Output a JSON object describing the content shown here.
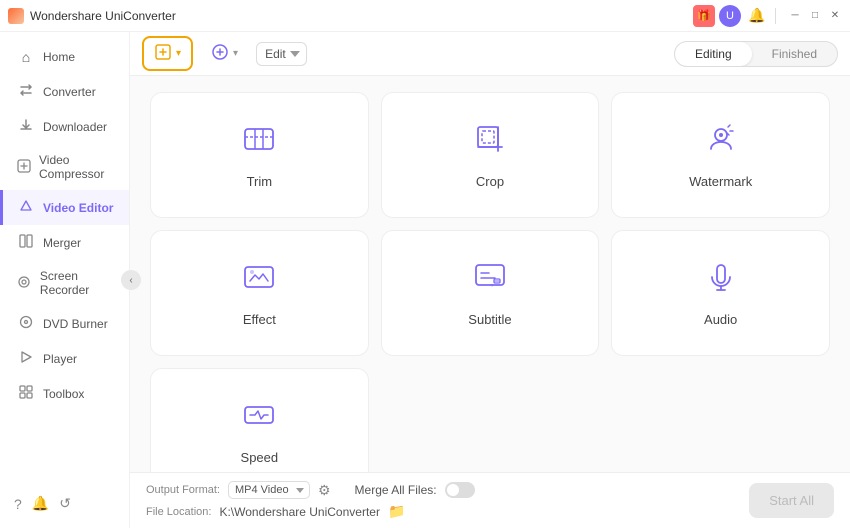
{
  "titleBar": {
    "title": "Wondershare UniConverter",
    "giftIcon": "🎁",
    "avatarLabel": "U",
    "bellIcon": "🔔",
    "minIcon": "─",
    "maxIcon": "□",
    "closeIcon": "✕"
  },
  "sidebar": {
    "items": [
      {
        "id": "home",
        "label": "Home",
        "icon": "⌂"
      },
      {
        "id": "converter",
        "label": "Converter",
        "icon": "⇄"
      },
      {
        "id": "downloader",
        "label": "Downloader",
        "icon": "↓"
      },
      {
        "id": "video-compressor",
        "label": "Video Compressor",
        "icon": "⊡"
      },
      {
        "id": "video-editor",
        "label": "Video Editor",
        "icon": "✏",
        "active": true
      },
      {
        "id": "merger",
        "label": "Merger",
        "icon": "⊕"
      },
      {
        "id": "screen-recorder",
        "label": "Screen Recorder",
        "icon": "◎"
      },
      {
        "id": "dvd-burner",
        "label": "DVD Burner",
        "icon": "💿"
      },
      {
        "id": "player",
        "label": "Player",
        "icon": "▶"
      },
      {
        "id": "toolbox",
        "label": "Toolbox",
        "icon": "⊞"
      }
    ],
    "bottomIcons": [
      "?",
      "🔔",
      "↺"
    ],
    "collapseLabel": "‹"
  },
  "toolbar": {
    "addFileLabel": "",
    "addFileArrow": "▾",
    "addFileIcon": "➕",
    "addSceneLabel": "",
    "addSceneArrow": "▾",
    "editOptions": [
      "Edit"
    ],
    "tabs": [
      {
        "id": "editing",
        "label": "Editing",
        "active": true
      },
      {
        "id": "finished",
        "label": "Finished",
        "active": false
      }
    ]
  },
  "grid": {
    "cards": [
      {
        "id": "trim",
        "label": "Trim",
        "iconType": "trim"
      },
      {
        "id": "crop",
        "label": "Crop",
        "iconType": "crop"
      },
      {
        "id": "watermark",
        "label": "Watermark",
        "iconType": "watermark"
      },
      {
        "id": "effect",
        "label": "Effect",
        "iconType": "effect"
      },
      {
        "id": "subtitle",
        "label": "Subtitle",
        "iconType": "subtitle"
      },
      {
        "id": "audio",
        "label": "Audio",
        "iconType": "audio"
      },
      {
        "id": "speed",
        "label": "Speed",
        "iconType": "speed"
      }
    ]
  },
  "bottomBar": {
    "outputFormatLabel": "Output Format:",
    "outputFormatValue": "MP4 Video",
    "mergeAllLabel": "Merge All Files:",
    "fileLocationLabel": "File Location:",
    "fileLocationValue": "K:\\Wondershare UniConverter",
    "startAllLabel": "Start All"
  }
}
